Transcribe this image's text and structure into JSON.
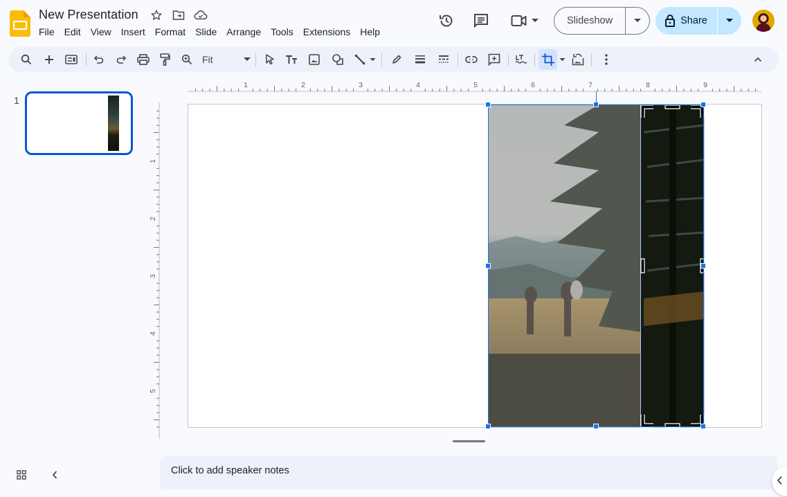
{
  "app": {
    "title": "New Presentation",
    "menu": [
      "File",
      "Edit",
      "View",
      "Insert",
      "Format",
      "Slide",
      "Arrange",
      "Tools",
      "Extensions",
      "Help"
    ],
    "title_icons": [
      "star-icon",
      "move-to-folder-icon",
      "cloud-saved-icon"
    ]
  },
  "header": {
    "icons": [
      "version-history-icon",
      "comments-icon",
      "meet-icon"
    ],
    "slideshow_label": "Slideshow",
    "share_label": "Share",
    "colors": {
      "share_bg": "#c2e7ff",
      "accent": "#0b57d0",
      "selection": "#1a73e8"
    }
  },
  "toolbar": {
    "zoom_value": "Fit",
    "tools": [
      "search-menus",
      "new-slide",
      "layout",
      "undo",
      "redo",
      "print",
      "paint-format",
      "zoom",
      "select",
      "text-box",
      "insert-image",
      "shape",
      "line",
      "border-color",
      "border-weight",
      "border-dash",
      "insert-link",
      "add-comment",
      "alt-text",
      "crop-image",
      "reset-image",
      "more-options",
      "collapse-toolbar"
    ],
    "active_tool": "crop-image"
  },
  "filmstrip": {
    "slides": [
      {
        "number": "1",
        "selected": true
      }
    ]
  },
  "rulers": {
    "horizontal_labels": [
      "1",
      "2",
      "3",
      "4",
      "5",
      "6",
      "7",
      "8",
      "9"
    ],
    "vertical_labels": [
      "1",
      "2",
      "3",
      "4",
      "5"
    ]
  },
  "slide": {
    "image": {
      "description": "Hikers in mountain meadow beside evergreen tree",
      "mode": "crop"
    }
  },
  "notes": {
    "placeholder": "Click to add speaker notes"
  }
}
